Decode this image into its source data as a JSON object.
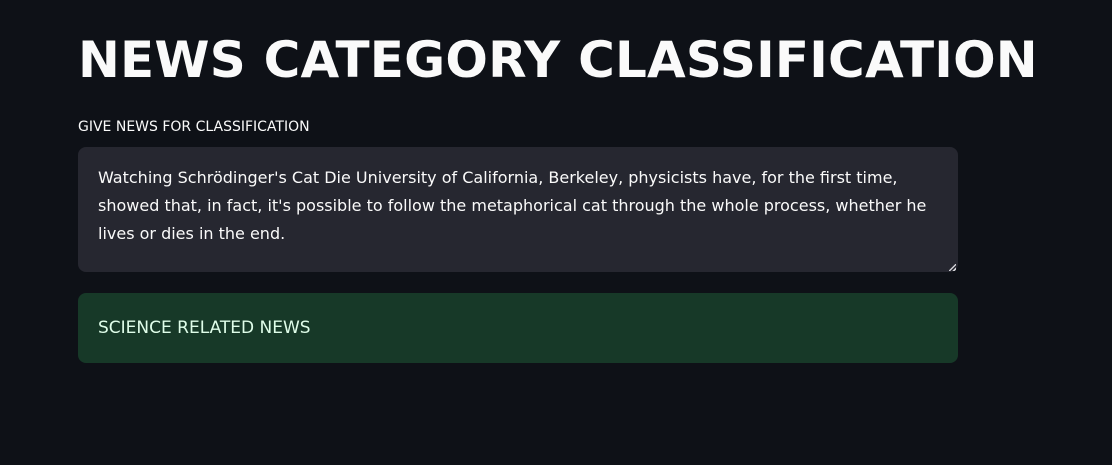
{
  "page": {
    "title": "NEWS CATEGORY CLASSIFICATION"
  },
  "input": {
    "label": "GIVE NEWS FOR CLASSIFICATION",
    "value": "Watching Schrödinger's Cat Die University of California, Berkeley, physicists have, for the first time, showed that, in fact, it's possible to follow the metaphorical cat through the whole process, whether he lives or dies in the end."
  },
  "result": {
    "text": "SCIENCE RELATED NEWS"
  },
  "colors": {
    "background": "#0e1117",
    "input_background": "#262730",
    "success_background": "#173928",
    "success_text": "#dffde9"
  }
}
